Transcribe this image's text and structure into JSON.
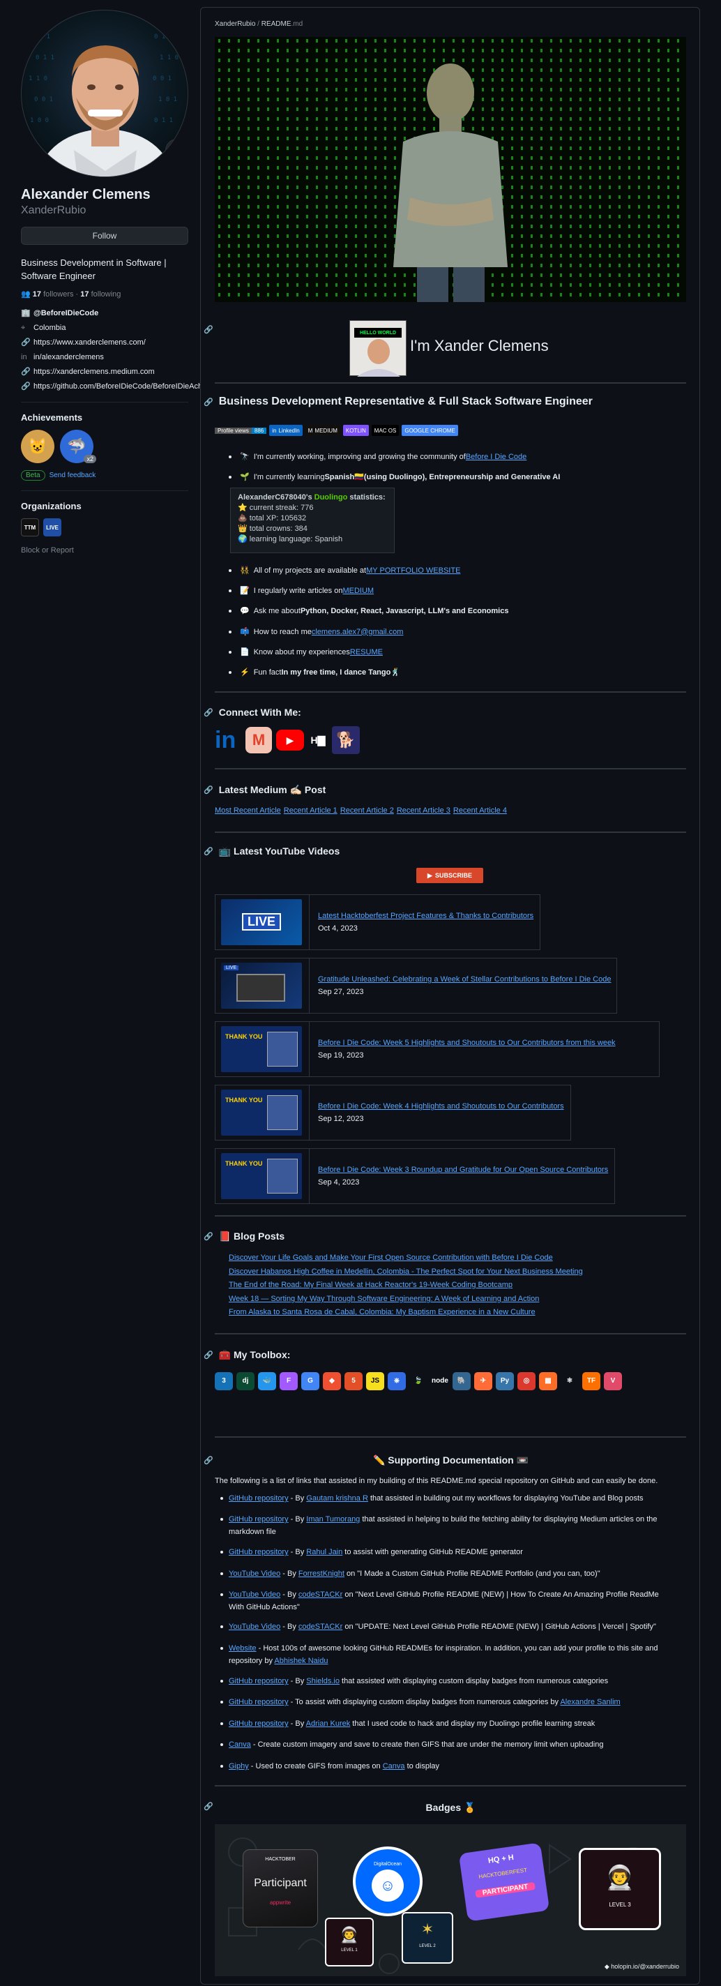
{
  "profile": {
    "name": "Alexander Clemens",
    "login": "XanderRubio",
    "status_emoji": "cr",
    "follow_label": "Follow",
    "bio": "Business Development in Software | Software Engineer",
    "followers": "17",
    "followers_label": "followers",
    "following": "17",
    "following_label": "following",
    "handle": "@BeforeIDieCode",
    "location": "Colombia",
    "links": [
      "https://www.xanderclemens.com/",
      "in/alexanderclemens",
      "https://xanderclemens.medium.com",
      "https://github.com/BeforeIDieCode/BeforeIDieAchievements"
    ]
  },
  "achievements": {
    "heading": "Achievements",
    "badge2_count": "x2",
    "beta": "Beta",
    "feedback": "Send feedback"
  },
  "organizations": {
    "heading": "Organizations",
    "orgs": [
      "TTM",
      "LIVE"
    ],
    "block": "Block or Report"
  },
  "readme": {
    "path_user": "XanderRubio",
    "path_sep": " / ",
    "path_file": "README",
    "path_ext": ".md",
    "intro_title": "I'm Xander Clemens",
    "hello_badge": "HELLO WORLD",
    "h_role": "Business Development Representative & Full Stack Software Engineer",
    "shields": [
      {
        "label": "Profile views",
        "value": "886",
        "color": "#007ec6"
      },
      {
        "label": "in",
        "value": "LinkedIn",
        "color": "#0a66c2"
      },
      {
        "label": "M",
        "value": "MEDIUM",
        "color": "#12100e"
      },
      {
        "label": "",
        "value": "KOTLIN",
        "color": "#7f52ff"
      },
      {
        "label": "",
        "value": "MAC OS",
        "color": "#000000"
      },
      {
        "label": "",
        "value": "GOOGLE CHROME",
        "color": "#4285f4"
      }
    ],
    "bullets": [
      {
        "emoji": "🔭",
        "pre": "I'm currently working, improving and growing the community of ",
        "link": "Before I Die Code",
        "post": ""
      },
      {
        "emoji": "🌱",
        "pre": "I'm currently learning ",
        "bold": "Spanish🇨🇴(using Duolingo), Entrepreneurship and Generative AI",
        "post": ""
      }
    ],
    "duolingo": {
      "user": "AlexanderC678040",
      "apos": "'s ",
      "brand": "Duolingo",
      "suffix": " statistics:",
      "streak": "current streak: 776",
      "xp": "total XP: 105632",
      "crowns": "total crowns: 384",
      "language": "learning language: Spanish"
    },
    "bullets2": [
      {
        "emoji": "👯",
        "pre": "All of my projects are available at ",
        "link": "MY PORTFOLIO WEBSITE"
      },
      {
        "emoji": "📝",
        "pre": "I regularly write articles on ",
        "link": "MEDIUM"
      },
      {
        "emoji": "💬",
        "pre": "Ask me about ",
        "bold": "Python, Docker, React, Javascript, LLM's and Economics"
      },
      {
        "emoji": "📫",
        "pre": "How to reach me ",
        "link": "clemens.alex7@gmail.com"
      },
      {
        "emoji": "📄",
        "pre": "Know about my experiences ",
        "link": "RESUME"
      },
      {
        "emoji": "⚡",
        "pre": "Fun fact ",
        "bold": "In my free time, I dance Tango🕺"
      }
    ],
    "h_connect": "Connect With Me:",
    "h_medium": "Latest Medium ✍🏻 Post",
    "medium_links": [
      "Most Recent Article",
      "Recent Article 1",
      "Recent Article 2",
      "Recent Article 3",
      "Recent Article 4"
    ],
    "h_youtube": "📺 Latest YouTube Videos",
    "subscribe": "SUBSCRIBE",
    "videos": [
      {
        "title": "Latest Hacktoberfest Project Features & Thanks to Contributors",
        "date": "Oct 4, 2023",
        "badge": "LIVE"
      },
      {
        "title": "Gratitude Unleashed: Celebrating a Week of Stellar Contributions to Before I Die Code",
        "date": "Sep 27, 2023",
        "badge": "LIVE"
      },
      {
        "title": "Before I Die Code: Week 5 Highlights and Shoutouts to Our Contributors from this week",
        "date": "Sep 19, 2023",
        "badge": "THANK YOU"
      },
      {
        "title": "Before I Die Code: Week 4 Highlights and Shoutouts to Our Contributors",
        "date": "Sep 12, 2023",
        "badge": "THANK YOU"
      },
      {
        "title": "Before I Die Code: Week 3 Roundup and Gratitude for Our Open Source Contributors",
        "date": "Sep 4, 2023",
        "badge": "THANK YOU"
      }
    ],
    "h_blog": "📕 Blog Posts",
    "blog_posts": [
      "Discover Your Life Goals and Make Your First Open Source Contribution with Before I Die Code",
      "Discover Habanos High Coffee in Medellin, Colombia - The Perfect Spot for Your Next Business Meeting",
      "The End of the Road: My Final Week at Hack Reactor's 19-Week Coding Bootcamp",
      "Week 18 — Sorting My Way Through Software Engineering: A Week of Learning and Action",
      "From Alaska to Santa Rosa de Cabal, Colombia: My Baptism Experience in a New Culture"
    ],
    "h_toolbox": "🧰 My Toolbox:",
    "tools": [
      {
        "name": "css3-icon",
        "label": "3",
        "color": "#1572b6"
      },
      {
        "name": "django-icon",
        "label": "dj",
        "color": "#0c4b33"
      },
      {
        "name": "docker-icon",
        "label": "🐳",
        "color": "#2496ed"
      },
      {
        "name": "figma-icon",
        "label": "F",
        "color": "#a259ff"
      },
      {
        "name": "gcp-icon",
        "label": "G",
        "color": "#4285f4"
      },
      {
        "name": "git-icon",
        "label": "◆",
        "color": "#f05032"
      },
      {
        "name": "html5-icon",
        "label": "5",
        "color": "#e34f26"
      },
      {
        "name": "javascript-icon",
        "label": "JS",
        "color": "#f7df1e"
      },
      {
        "name": "kubernetes-icon",
        "label": "⎈",
        "color": "#326ce5"
      },
      {
        "name": "mongodb-icon",
        "label": "🍃",
        "color": "#0d1117"
      },
      {
        "name": "nodejs-icon",
        "label": "node",
        "color": "#0d1117"
      },
      {
        "name": "postgresql-icon",
        "label": "🐘",
        "color": "#336791"
      },
      {
        "name": "postman-icon",
        "label": "✈",
        "color": "#ff6c37"
      },
      {
        "name": "python-icon",
        "label": "Py",
        "color": "#3776ab"
      },
      {
        "name": "redis-icon",
        "label": "◎",
        "color": "#dc382d"
      },
      {
        "name": "gitlab-icon",
        "label": "▦",
        "color": "#fc6d26"
      },
      {
        "name": "react-icon",
        "label": "⚛",
        "color": "#0d1117"
      },
      {
        "name": "tensorflow-icon",
        "label": "TF",
        "color": "#ff6f00"
      },
      {
        "name": "vue-icon",
        "label": "V",
        "color": "#e24a6a"
      }
    ],
    "h_docs": "✏️ Supporting Documentation 📼",
    "docs_intro": "The following is a list of links that assisted in my building of this README.md special repository on GitHub and can easily be done.",
    "docs": [
      {
        "link": "GitHub repository",
        "text": " - By ",
        "author": "Gautam krishna R",
        "rest": " that assisted in building out my workflows for displaying YouTube and Blog posts"
      },
      {
        "link": "GitHub repository",
        "text": " - By ",
        "author": "Iman Tumorang",
        "rest": " that assisted in helping to build the fetching ability for displaying Medium articles on the markdown file"
      },
      {
        "link": "GitHub repository",
        "text": " - By ",
        "author": "Rahul Jain",
        "rest": " to assist with generating GitHub README generator"
      },
      {
        "link": "YouTube Video",
        "text": " - By ",
        "author": "ForrestKnight",
        "rest": " on \"I Made a Custom GitHub Profile README Portfolio (and you can, too)\""
      },
      {
        "link": "YouTube Video",
        "text": " - By ",
        "author": "codeSTACKr",
        "rest": " on \"Next Level GitHub Profile README (NEW) | How To Create An Amazing Profile ReadMe With GitHub Actions\""
      },
      {
        "link": "YouTube Video",
        "text": " - By ",
        "author": "codeSTACKr",
        "rest": " on \"UPDATE: Next Level GitHub Profile README (NEW) | GitHub Actions | Vercel | Spotify\""
      },
      {
        "link": "Website",
        "text": " - Host 100s of awesome looking GitHub READMEs for inspiration. In addition, you can add your profile to this site and repository by ",
        "author": "Abhishek Naidu",
        "rest": ""
      },
      {
        "link": "GitHub repository",
        "text": " - By ",
        "author": "Shields.io",
        "rest": " that assisted with displaying custom display badges from numerous categories"
      },
      {
        "link": "GitHub repository",
        "text": " - To assist with displaying custom display badges from numerous categories by ",
        "author": "Alexandre Sanlim",
        "rest": ""
      },
      {
        "link": "GitHub repository",
        "text": " - By ",
        "author": "Adrian Kurek",
        "rest": " that I used code to hack and display my Duolingo profile learning streak"
      },
      {
        "link": "Canva",
        "text": " - Create custom imagery and save to create then GIFS that are under the memory limit when uploading",
        "author": "",
        "rest": ""
      },
      {
        "link": "Giphy",
        "text": " - Used to create GIFS from images on ",
        "author": "Canva",
        "rest": " to display"
      }
    ],
    "h_badges": "Badges 🏅",
    "badges": {
      "hacktober": "HACKTOBER",
      "participant": "Participant",
      "appwrite": "appwrite",
      "do": "DigitalOcean",
      "hq": "HQ + H",
      "fest": "HACKTOBERFEST",
      "part2": "PARTICIPANT",
      "level3": "LEVEL 3",
      "level1": "LEVEL 1",
      "level2": "LEVEL 2",
      "holopin": "holopin.io/@xanderrubio"
    }
  }
}
